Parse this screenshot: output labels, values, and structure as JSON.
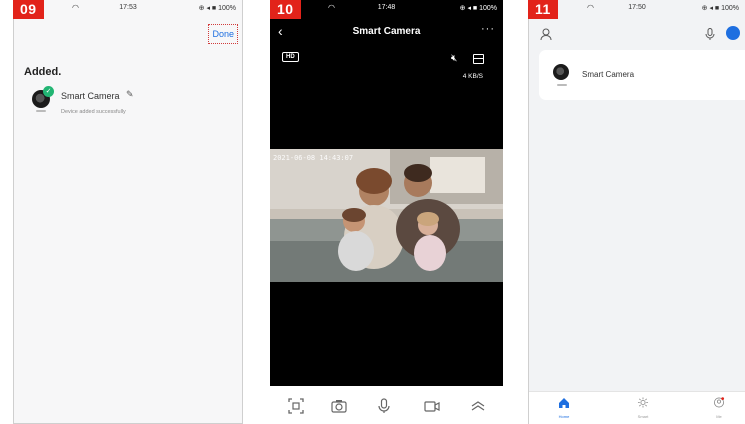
{
  "panels": [
    {
      "step": "09",
      "status_time": "17:53",
      "status_right": "⊕ ◂ ■ 100%",
      "done_label": "Done",
      "section_title": "Added.",
      "device_name": "Smart Camera",
      "device_status": "Device added successfully"
    },
    {
      "step": "10",
      "status_time": "17:48",
      "status_right": "⊕ ◂ ■ 100%",
      "title": "Smart Camera",
      "more_label": "···",
      "hd_label": "HD",
      "rate": "4 KB/S",
      "timestamp": "2021-06-08 14:43:07"
    },
    {
      "step": "11",
      "status_time": "17:50",
      "status_right": "⊕ ◂ ■ 100%",
      "device_name": "Smart Camera",
      "tabs": [
        {
          "label": "Home",
          "icon": "home-icon"
        },
        {
          "label": "Smart",
          "icon": "sun-icon"
        },
        {
          "label": "Me",
          "icon": "profile-icon"
        }
      ]
    }
  ],
  "colors": {
    "badge": "#e2231a",
    "accent": "#1e6fe0",
    "success": "#22b573"
  }
}
